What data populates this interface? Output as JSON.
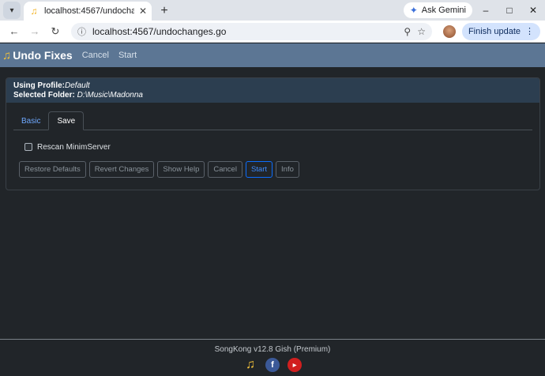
{
  "browser": {
    "tab_title": "localhost:4567/undochanges.go",
    "url": "localhost:4567/undochanges.go",
    "gemini_label": "Ask Gemini",
    "finish_update_label": "Finish update"
  },
  "nav": {
    "brand": "Undo Fixes",
    "links": [
      "Cancel",
      "Start"
    ]
  },
  "header": {
    "profile_label": "Using Profile:",
    "profile_value": "Default",
    "folder_label": "Selected Folder:",
    "folder_value": "D:\\Music\\Madonna"
  },
  "tabs": [
    "Basic",
    "Save"
  ],
  "checkbox": {
    "label": "Rescan MinimServer",
    "checked": false
  },
  "buttons": [
    "Restore Defaults",
    "Revert Changes",
    "Show Help",
    "Cancel",
    "Start",
    "Info"
  ],
  "footer": {
    "version": "SongKong v12.8 Gish (Premium)"
  },
  "colors": {
    "accent": "#0d6efd",
    "nav_bg": "#5c7694",
    "header_bg": "#2c3e50",
    "page_bg": "#212529"
  }
}
